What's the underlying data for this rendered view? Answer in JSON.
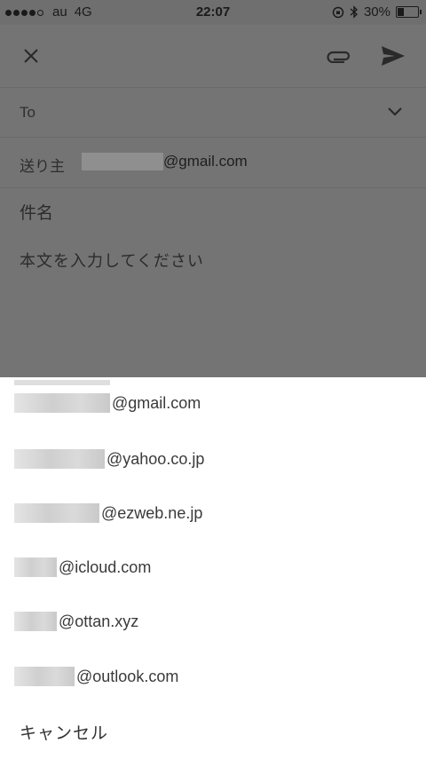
{
  "status_bar": {
    "carrier": "au",
    "network": "4G",
    "time": "22:07",
    "battery": "30%",
    "battery_level": 0.3
  },
  "compose": {
    "to_label": "To",
    "from_label": "送り主",
    "from_email_domain": "@gmail.com",
    "subject_placeholder": "件名",
    "body_placeholder": "本文を入力してください"
  },
  "action_sheet": {
    "options": [
      {
        "domain": "@gmail.com"
      },
      {
        "domain": "@yahoo.co.jp"
      },
      {
        "domain": "@ezweb.ne.jp"
      },
      {
        "domain": "@icloud.com"
      },
      {
        "domain": "@ottan.xyz"
      },
      {
        "domain": "@outlook.com"
      }
    ],
    "cancel_label": "キャンセル"
  },
  "colors": {
    "overlay": "#747474",
    "sheet_bg": "#ffffff",
    "text": "#333333"
  },
  "icons": [
    "close-icon",
    "attachment-icon",
    "send-icon",
    "chevron-down-icon",
    "bluetooth-icon",
    "battery-icon"
  ]
}
